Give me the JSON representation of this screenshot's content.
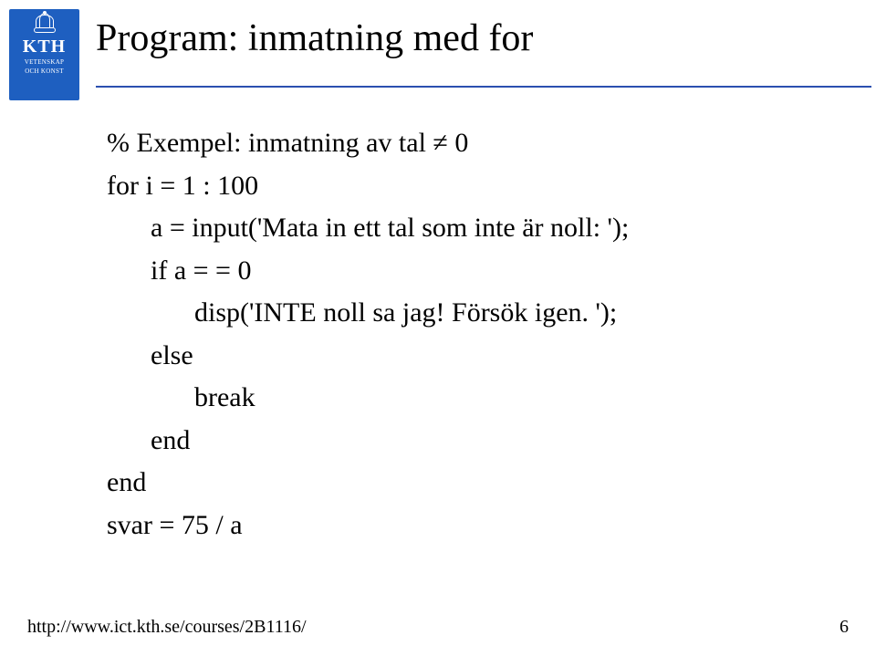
{
  "logo": {
    "name": "KTH",
    "sub1": "VETENSKAP",
    "sub2": "OCH KONST"
  },
  "title": "Program: inmatning med for",
  "code": {
    "l0": "% Exempel: inmatning av tal ≠ 0",
    "l1": "for i = 1 : 100",
    "l2": "a = input('Mata in ett tal som inte är noll: ');",
    "l3": "if a = = 0",
    "l4": "disp('INTE noll sa jag! Försök igen. ');",
    "l5": "else",
    "l6": "break",
    "l7": "end",
    "l8": "end",
    "l9": "svar = 75 / a"
  },
  "footer": {
    "url": "http://www.ict.kth.se/courses/2B1116/",
    "page": "6"
  }
}
